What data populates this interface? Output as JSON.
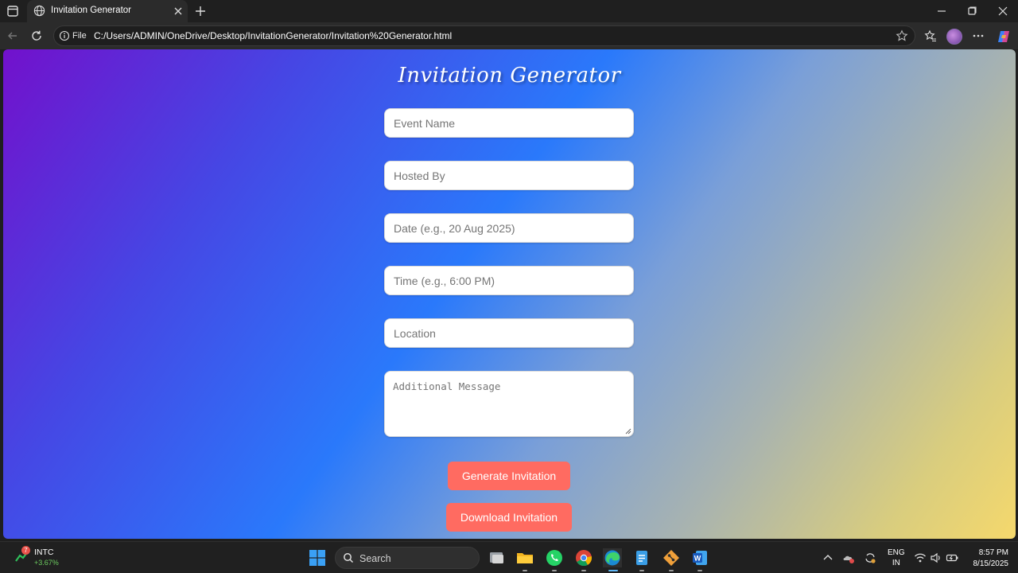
{
  "browser": {
    "tab_title": "Invitation Generator",
    "url_scheme": "File",
    "url": "C:/Users/ADMIN/OneDrive/Desktop/InvitationGenerator/Invitation%20Generator.html"
  },
  "page": {
    "title": "Invitation Generator",
    "fields": {
      "event_name": "Event Name",
      "hosted_by": "Hosted By",
      "date": "Date (e.g., 20 Aug 2025)",
      "time": "Time (e.g., 6:00 PM)",
      "location": "Location",
      "message": "Additional Message"
    },
    "buttons": {
      "generate": "Generate Invitation",
      "download": "Download Invitation"
    },
    "colors": {
      "button": "#ff6b61",
      "gradient_start": "#7211cc",
      "gradient_mid": "#2a79fb",
      "gradient_end": "#f5d86c"
    }
  },
  "taskbar": {
    "stock": {
      "badge": "7",
      "ticker": "INTC",
      "change": "+3.67%"
    },
    "search_label": "Search",
    "language": {
      "line1": "ENG",
      "line2": "IN"
    },
    "clock": {
      "time": "8:57 PM",
      "date": "8/15/2025"
    },
    "apps": [
      "task-view",
      "file-explorer",
      "whatsapp",
      "chrome",
      "edge",
      "notepad",
      "git",
      "word"
    ]
  }
}
